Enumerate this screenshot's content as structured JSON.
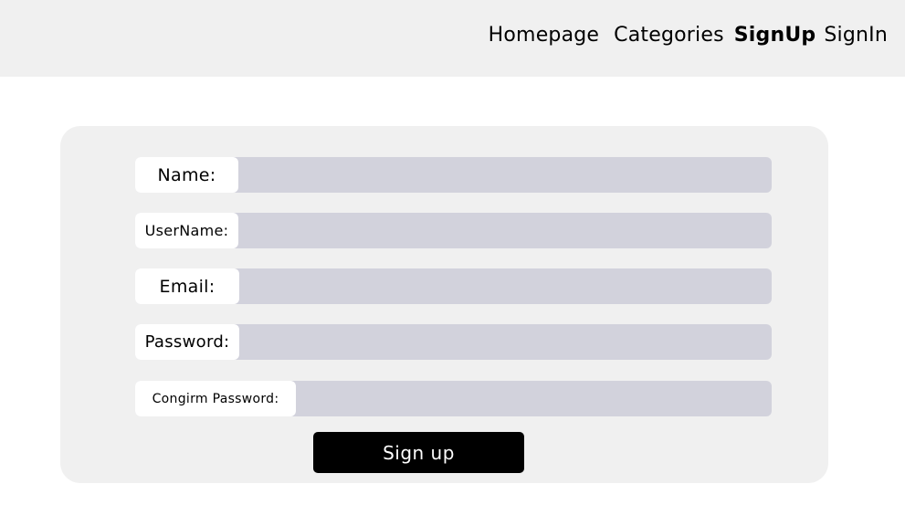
{
  "nav": {
    "items": [
      {
        "label": "Homepage"
      },
      {
        "label": "Categories"
      },
      {
        "label": "SignUp"
      },
      {
        "label": "SignIn"
      }
    ],
    "active": "SignUp"
  },
  "form": {
    "fields": [
      {
        "label": "Name:",
        "value": ""
      },
      {
        "label": "UserName:",
        "value": ""
      },
      {
        "label": "Email:",
        "value": ""
      },
      {
        "label": "Password:",
        "value": ""
      },
      {
        "label": "Congirm Password:",
        "value": ""
      }
    ],
    "submit_label": "Sign up"
  },
  "colors": {
    "header_bg": "#f0f0f0",
    "card_bg": "#f0f0f0",
    "input_bg": "#d2d2dc",
    "button_bg": "#000000",
    "button_text": "#ffffff"
  }
}
